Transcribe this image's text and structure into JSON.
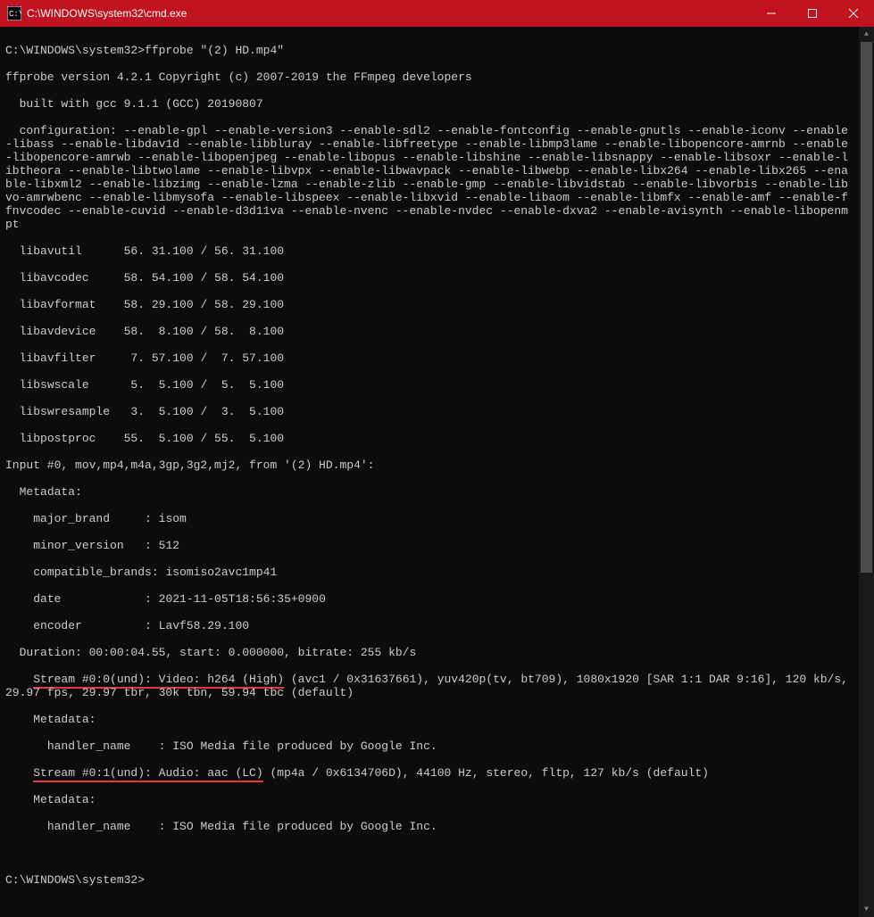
{
  "titlebar": {
    "icon_label": "cmd-icon",
    "title": "C:\\WINDOWS\\system32\\cmd.exe",
    "minimize": "–",
    "maximize": "▢",
    "close": "✕"
  },
  "prompt1": "C:\\WINDOWS\\system32>",
  "command1": "ffprobe \"(2) HD.mp4\"",
  "lines": [
    "ffprobe version 4.2.1 Copyright (c) 2007-2019 the FFmpeg developers",
    "  built with gcc 9.1.1 (GCC) 20190807",
    "  configuration: --enable-gpl --enable-version3 --enable-sdl2 --enable-fontconfig --enable-gnutls --enable-iconv --enable-libass --enable-libdav1d --enable-libbluray --enable-libfreetype --enable-libmp3lame --enable-libopencore-amrnb --enable-libopencore-amrwb --enable-libopenjpeg --enable-libopus --enable-libshine --enable-libsnappy --enable-libsoxr --enable-libtheora --enable-libtwolame --enable-libvpx --enable-libwavpack --enable-libwebp --enable-libx264 --enable-libx265 --enable-libxml2 --enable-libzimg --enable-lzma --enable-zlib --enable-gmp --enable-libvidstab --enable-libvorbis --enable-libvo-amrwbenc --enable-libmysofa --enable-libspeex --enable-libxvid --enable-libaom --enable-libmfx --enable-amf --enable-ffnvcodec --enable-cuvid --enable-d3d11va --enable-nvenc --enable-nvdec --enable-dxva2 --enable-avisynth --enable-libopenmpt",
    "  libavutil      56. 31.100 / 56. 31.100",
    "  libavcodec     58. 54.100 / 58. 54.100",
    "  libavformat    58. 29.100 / 58. 29.100",
    "  libavdevice    58.  8.100 / 58.  8.100",
    "  libavfilter     7. 57.100 /  7. 57.100",
    "  libswscale      5.  5.100 /  5.  5.100",
    "  libswresample   3.  5.100 /  3.  5.100",
    "  libpostproc    55.  5.100 / 55.  5.100",
    "Input #0, mov,mp4,m4a,3gp,3g2,mj2, from '(2) HD.mp4':",
    "  Metadata:",
    "    major_brand     : isom",
    "    minor_version   : 512",
    "    compatible_brands: isomiso2avc1mp41",
    "    date            : 2021-11-05T18:56:35+0900",
    "    encoder         : Lavf58.29.100",
    "  Duration: 00:00:04.55, start: 0.000000, bitrate: 255 kb/s"
  ],
  "stream0_pre": "    ",
  "stream0_ul": "Stream #0:0(und): Video: h264 (High)",
  "stream0_rest": " (avc1 / 0x31637661), yuv420p(tv, bt709), 1080x1920 [SAR 1:1 DAR 9:16], 120 kb/s, 29.97 fps, 29.97 tbr, 30k tbn, 59.94 tbc (default)",
  "meta1": "    Metadata:",
  "handler1": "      handler_name    : ISO Media file produced by Google Inc.",
  "stream1_pre": "    ",
  "stream1_ul": "Stream #0:1(und): Audio: aac (LC)",
  "stream1_rest": " (mp4a / 0x6134706D), 44100 Hz, stereo, fltp, 127 kb/s (default)",
  "meta2": "    Metadata:",
  "handler2": "      handler_name    : ISO Media file produced by Google Inc.",
  "prompt2": "C:\\WINDOWS\\system32>"
}
